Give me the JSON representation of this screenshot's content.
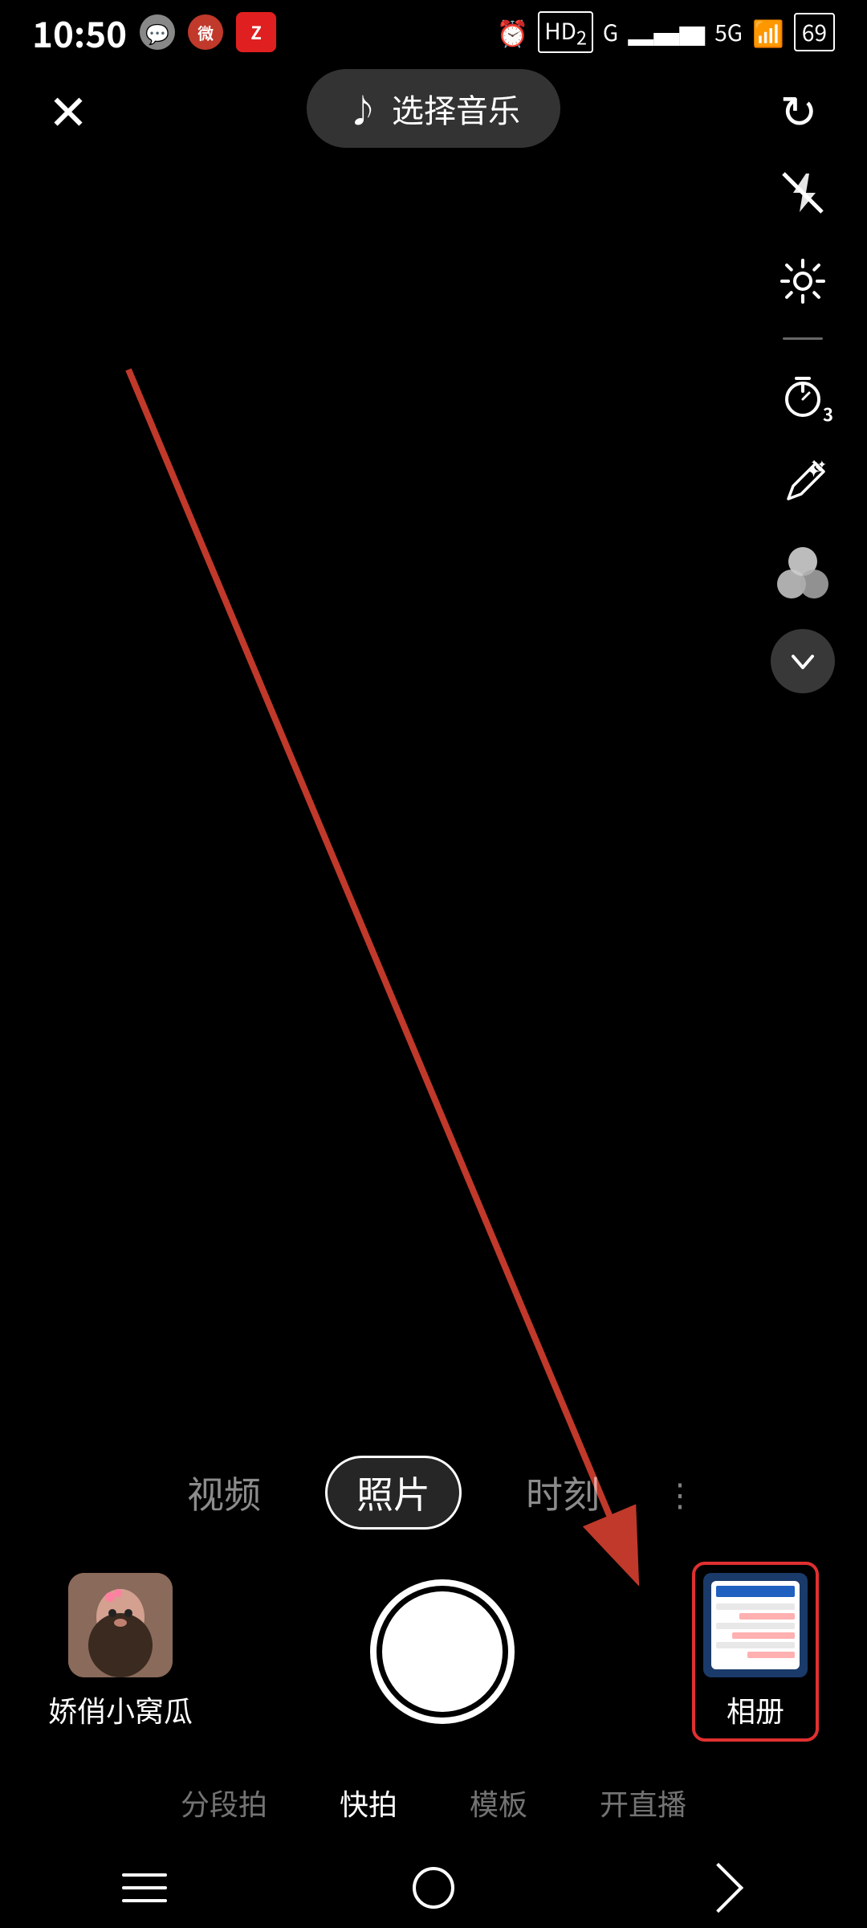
{
  "statusBar": {
    "time": "10:50",
    "leftIcons": [
      "chat-icon",
      "weibo-icon",
      "zhibo-icon"
    ],
    "rightIcons": {
      "alarm": "⏰",
      "hd": "HD₂",
      "signal4g": "G",
      "signal5g": "5G",
      "wifi": "📶",
      "battery": "69"
    }
  },
  "topBar": {
    "closeLabel": "✕",
    "musicNote": "♪",
    "musicLabel": "选择音乐",
    "refreshLabel": "↻"
  },
  "rightToolbar": {
    "flashLabel": "⚡",
    "settingsLabel": "⚙",
    "timerLabel": "⏱",
    "timerNumber": "3",
    "brushLabel": "✏",
    "colorsLabel": "colors",
    "chevronLabel": "∨"
  },
  "modeTabs": [
    {
      "label": "视频",
      "active": false
    },
    {
      "label": "照片",
      "active": true
    },
    {
      "label": "时刻",
      "active": false
    }
  ],
  "moreLabel": "⋮",
  "user": {
    "name": "娇俏小窝瓜"
  },
  "album": {
    "label": "相册"
  },
  "bottomNav": [
    {
      "label": "分段拍",
      "active": false
    },
    {
      "label": "快拍",
      "active": true
    },
    {
      "label": "模板",
      "active": false
    },
    {
      "label": "开直播",
      "active": false
    }
  ],
  "sysNav": {
    "menu": "≡",
    "home": "○",
    "back": "<"
  }
}
